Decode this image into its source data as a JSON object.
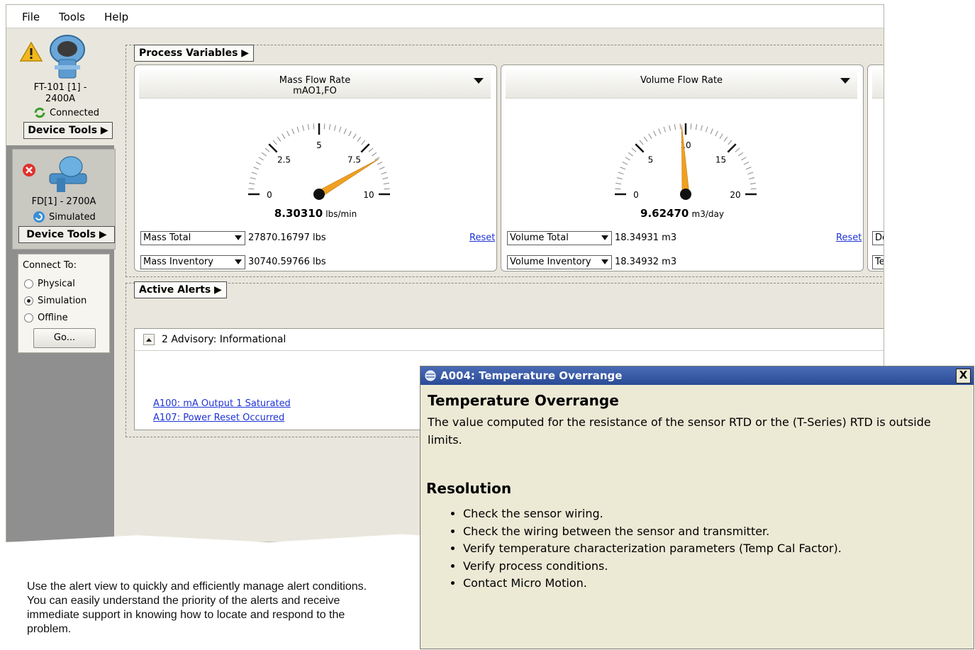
{
  "menu": [
    "File",
    "Tools",
    "Help"
  ],
  "devices": [
    {
      "name": "FT-101  [1] -\n2400A",
      "status": "Connected",
      "tools_label": "Device Tools ▶"
    },
    {
      "name": "FD[1] - 2700A",
      "status": "Simulated",
      "tools_label": "Device Tools ▶"
    }
  ],
  "connect": {
    "title": "Connect To:",
    "options": [
      "Physical",
      "Simulation",
      "Offline"
    ],
    "selected": "Simulation",
    "go_label": "Go..."
  },
  "process_variables": {
    "label": "Process Variables ▶",
    "gauges": [
      {
        "title": "Mass Flow Rate",
        "subtitle": "mAO1,FO",
        "value": "8.30310",
        "value_num": 8.3031,
        "unit": "lbs/min",
        "ticks": [
          "0",
          "2.5",
          "5",
          "7.5",
          "10"
        ],
        "range": [
          0,
          10
        ],
        "needle_color": "#f0a020",
        "total_select": "Mass Total",
        "total_value": "27870.16797 lbs",
        "inventory_select": "Mass Inventory",
        "inventory_value": "30740.59766 lbs",
        "reset_label": "Reset"
      },
      {
        "title": "Volume Flow Rate",
        "subtitle": "",
        "value": "9.62470",
        "value_num": 9.6247,
        "unit": "m3/day",
        "ticks": [
          "0",
          "5",
          "10",
          "15",
          "20"
        ],
        "range": [
          0,
          20
        ],
        "needle_color": "#f0a020",
        "total_select": "Volume Total",
        "total_value": "18.34931 m3",
        "inventory_select": "Volume Inventory",
        "inventory_value": "18.34932 m3",
        "reset_label": "Reset"
      }
    ],
    "partial_selects": [
      "De",
      "Te"
    ]
  },
  "active_alerts": {
    "label": "Active Alerts ▶",
    "group_label": "2 Advisory: Informational",
    "items": [
      "A100: mA Output 1 Saturated",
      "A107: Power Reset Occurred"
    ]
  },
  "popup": {
    "title": "A004: Temperature Overrange",
    "close_label": "X",
    "heading": "Temperature Overrange",
    "description": "The value computed for the resistance of the sensor RTD or the (T-Series) RTD is outside limits.",
    "resolution_heading": "Resolution",
    "steps": [
      "Check the sensor wiring.",
      "Check the wiring between the sensor and transmitter.",
      "Verify temperature characterization parameters (Temp Cal Factor).",
      "Verify process conditions.",
      "Contact Micro Motion."
    ]
  },
  "caption": "Use the alert view to quickly and efficiently manage alert conditions. You can easily understand the priority of the alerts and receive immediate support in knowing how to locate and respond to the problem.",
  "colors": {
    "titlebar": "#2a4a96",
    "link": "#1e33d6",
    "needle": "#f0a020",
    "warning": "#f2b81c"
  }
}
